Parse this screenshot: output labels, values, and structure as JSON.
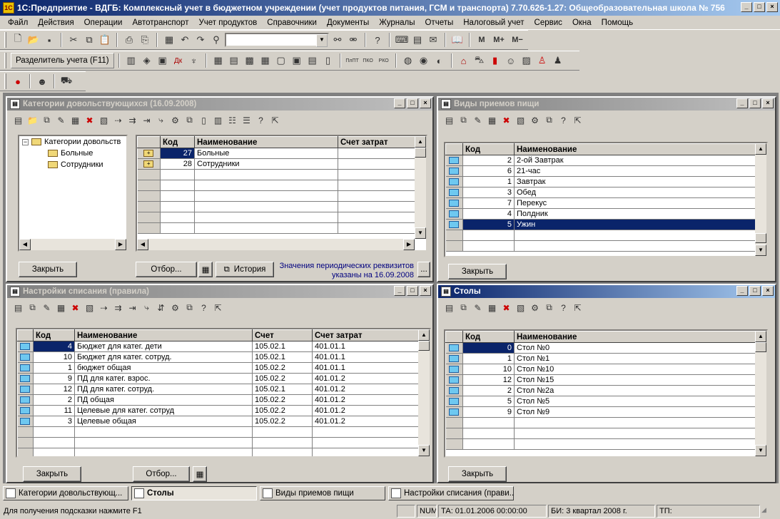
{
  "app": {
    "title": "1С:Предприятие - ВДГБ: Комплексный учет в бюджетном учреждении (учет продуктов питания, ГСМ и транспорта) 7.70.626-1.27: Общеобразовательная школа № 756",
    "icon": "1c-app-icon"
  },
  "menu": [
    "Файл",
    "Действия",
    "Операции",
    "Автотранспорт",
    "Учет продуктов",
    "Справочники",
    "Документы",
    "Журналы",
    "Отчеты",
    "Налоговый учет",
    "Сервис",
    "Окна",
    "Помощь"
  ],
  "toolbar": {
    "combo_value": "",
    "m_buttons": [
      "М",
      "М+",
      "М−"
    ],
    "divider_label": "Разделитель учета (F11)"
  },
  "win_categories": {
    "title": "Категории довольствующихся (16.09.2008)",
    "tree_root": "Категории довольств",
    "tree_children": [
      "Больные",
      "Сотрудники"
    ],
    "columns": [
      "Код",
      "Наименование",
      "Счет затрат"
    ],
    "rows": [
      {
        "code": "27",
        "name": "Больные",
        "account": ""
      },
      {
        "code": "28",
        "name": "Сотрудники",
        "account": ""
      }
    ],
    "btn_close": "Закрыть",
    "btn_filter": "Отбор...",
    "btn_history": "История",
    "note_line1": "Значения периодических реквизитов",
    "note_line2": "указаны на 16.09.2008"
  },
  "win_meals": {
    "title": "Виды приемов пищи",
    "columns": [
      "Код",
      "Наименование"
    ],
    "rows": [
      {
        "code": "2",
        "name": "2-ой Завтрак"
      },
      {
        "code": "6",
        "name": "21-час"
      },
      {
        "code": "1",
        "name": "Завтрак"
      },
      {
        "code": "3",
        "name": "Обед"
      },
      {
        "code": "7",
        "name": "Перекус"
      },
      {
        "code": "4",
        "name": "Полдник"
      },
      {
        "code": "5",
        "name": "Ужин"
      }
    ],
    "btn_close": "Закрыть"
  },
  "win_rules": {
    "title": "Настройки списания (правила)",
    "columns": [
      "Код",
      "Наименование",
      "Счет",
      "Счет затрат"
    ],
    "rows": [
      {
        "code": "4",
        "name": "Бюджет для катег. дети",
        "acc": "105.02.1",
        "cost": "401.01.1"
      },
      {
        "code": "10",
        "name": "Бюджет для катег. сотруд.",
        "acc": "105.02.1",
        "cost": "401.01.1"
      },
      {
        "code": "1",
        "name": "бюджет общая",
        "acc": "105.02.2",
        "cost": "401.01.1"
      },
      {
        "code": "9",
        "name": "ПД для катег. взрос.",
        "acc": "105.02.2",
        "cost": "401.01.2"
      },
      {
        "code": "12",
        "name": "ПД для катег. сотруд.",
        "acc": "105.02.1",
        "cost": "401.01.2"
      },
      {
        "code": "2",
        "name": "ПД общая",
        "acc": "105.02.2",
        "cost": "401.01.2"
      },
      {
        "code": "11",
        "name": "Целевые для катег. сотруд",
        "acc": "105.02.2",
        "cost": "401.01.2"
      },
      {
        "code": "3",
        "name": "Целевые общая",
        "acc": "105.02.2",
        "cost": "401.01.2"
      }
    ],
    "btn_close": "Закрыть",
    "btn_filter": "Отбор..."
  },
  "win_tables": {
    "title": "Столы",
    "columns": [
      "Код",
      "Наименование"
    ],
    "rows": [
      {
        "code": "0",
        "name": "Стол №0"
      },
      {
        "code": "1",
        "name": "Стол №1"
      },
      {
        "code": "10",
        "name": "Стол №10"
      },
      {
        "code": "12",
        "name": "Стол №15"
      },
      {
        "code": "2",
        "name": "Стол №2а"
      },
      {
        "code": "5",
        "name": "Стол №5"
      },
      {
        "code": "9",
        "name": "Стол №9"
      }
    ],
    "btn_close": "Закрыть"
  },
  "taskbar": [
    "Категории довольствующ...",
    "Столы",
    "Виды приемов пищи",
    "Настройки списания (прави..."
  ],
  "status": {
    "hint": "Для получения подсказки нажмите F1",
    "num": "NUM",
    "ta": "ТА: 01.01.2006  00:00:00",
    "bi": "БИ: 3 квартал 2008 г.",
    "tp": "ТП:"
  },
  "colors": {
    "selection": "#0a246a",
    "active_title": "#0a246a",
    "face": "#d4d0c8"
  }
}
